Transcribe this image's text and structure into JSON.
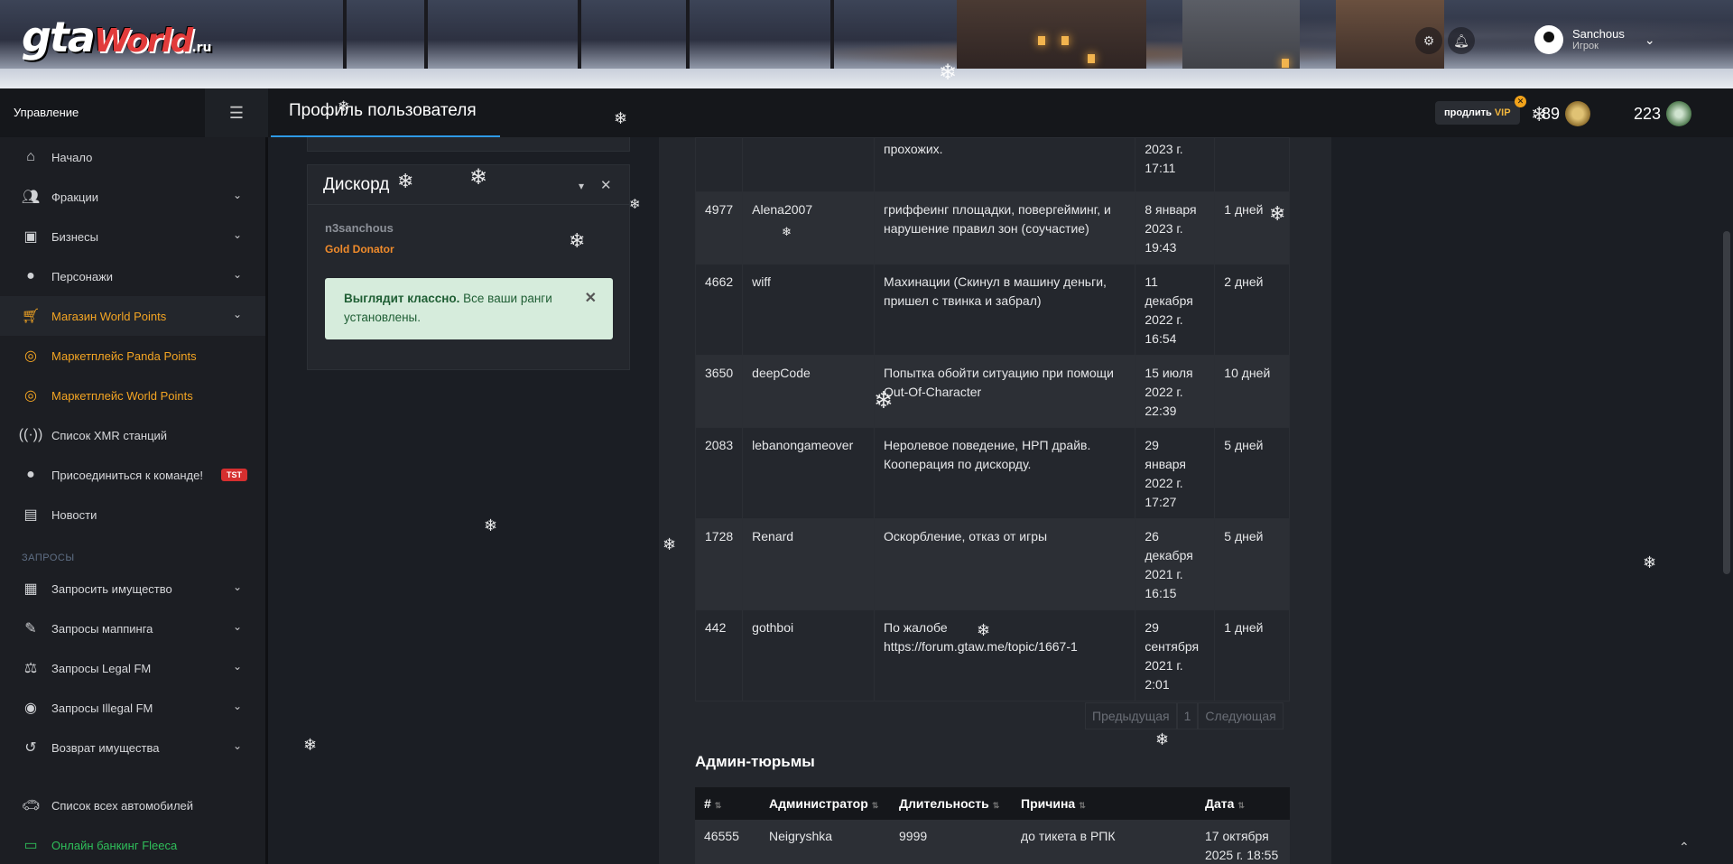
{
  "brand": {
    "logo_gta": "gta",
    "logo_world": "World",
    "logo_ru": ".ru"
  },
  "user": {
    "name": "Sanchous",
    "role": "Игрок"
  },
  "topbar": {
    "management_label": "Управление",
    "page_title": "Профиль пользователя",
    "vip_prefix": "продлить",
    "vip_label": "VIP",
    "vip_badge": "✕",
    "coins_1": "89",
    "coins_2": "223"
  },
  "sidebar": {
    "items": [
      {
        "label": "Начало",
        "icon": "home-icon"
      },
      {
        "label": "Фракции",
        "icon": "users-icon"
      },
      {
        "label": "Бизнесы",
        "icon": "briefcase-icon"
      },
      {
        "label": "Персонажи",
        "icon": "person-icon"
      },
      {
        "label": "Магазин World Points",
        "icon": "cart-icon"
      },
      {
        "label": "Маркетплейс Panda Points",
        "icon": "coins-icon"
      },
      {
        "label": "Маркетплейс World Points",
        "icon": "coins-icon"
      },
      {
        "label": "Список XMR станций",
        "icon": "broadcast-icon"
      },
      {
        "label": "Присоединиться к команде!",
        "icon": "person-icon",
        "badge": "TST"
      },
      {
        "label": "Новости",
        "icon": "newspaper-icon"
      }
    ],
    "section_requests": "ЗАПРОСЫ",
    "request_items": [
      {
        "label": "Запросить имущество",
        "icon": "building-icon"
      },
      {
        "label": "Запросы маппинга",
        "icon": "brush-icon"
      },
      {
        "label": "Запросы Legal FM",
        "icon": "scale-icon"
      },
      {
        "label": "Запросы Illegal FM",
        "icon": "mask-icon"
      },
      {
        "label": "Возврат имущества",
        "icon": "undo-icon"
      }
    ],
    "bottom_items": [
      {
        "label": "Список всех автомобилей",
        "icon": "car-icon"
      },
      {
        "label": "Онлайн банкинг Fleeca",
        "icon": "bank-card-icon"
      }
    ]
  },
  "discord_widget": {
    "title": "Дискорд",
    "username": "n3sanchous",
    "rank": "Gold Donator",
    "alert_bold": "Выглядит классно.",
    "alert_text": " Все ваши ранги установлены."
  },
  "bans_table": {
    "rows": [
      {
        "id": "",
        "admin": "",
        "reason": "прохожих.",
        "date": "2023 г.\n17:11",
        "duration": ""
      },
      {
        "id": "4977",
        "admin": "Alena2007",
        "reason": "гриффеинг площадки, повергейминг, и нарушение правил зон (соучастие)",
        "date": "8 января\n2023 г.\n19:43",
        "duration": "1 дней"
      },
      {
        "id": "4662",
        "admin": "wiff",
        "reason": "Махинации (Скинул в машину деньги, пришел с твинка и забрал)",
        "date": "11\nдекабря\n2022 г.\n16:54",
        "duration": "2 дней"
      },
      {
        "id": "3650",
        "admin": "deepCode",
        "reason": "Попытка обойти ситуацию при помощи Out-Of-Character",
        "date": "15 июля\n2022 г.\n22:39",
        "duration": "10 дней"
      },
      {
        "id": "2083",
        "admin": "lebanongameover",
        "reason": "Неролевое поведение, НРП драйв. Кооперация по дискорду.",
        "date": "29\nянваря\n2022 г.\n17:27",
        "duration": "5 дней"
      },
      {
        "id": "1728",
        "admin": "Renard",
        "reason": "Оскорбление, отказ от игры",
        "date": "26\nдекабря\n2021 г.\n16:15",
        "duration": "5 дней"
      },
      {
        "id": "442",
        "admin": "gothboi",
        "reason": "По жалобе https://forum.gtaw.me/topic/1667-1",
        "date": "29\nсентября\n2021 г.\n2:01",
        "duration": "1 дней"
      }
    ],
    "pagination": {
      "prev": "Предыдущая",
      "page": "1",
      "next": "Следующая"
    }
  },
  "admin_jails": {
    "title": "Админ-тюрьмы",
    "columns": [
      "#",
      "Администратор",
      "Длительность",
      "Причина",
      "Дата"
    ],
    "rows": [
      {
        "id": "46555",
        "admin": "Neigryshka",
        "duration": "9999",
        "reason": "до тикета в РПК",
        "date": "17 октября\n2025 г. 18:55"
      }
    ]
  },
  "colors": {
    "accent_orange": "#f4a523",
    "accent_blue": "#2e9ae6",
    "green": "#2fbf5a",
    "alert_bg": "#d6ecdc"
  }
}
